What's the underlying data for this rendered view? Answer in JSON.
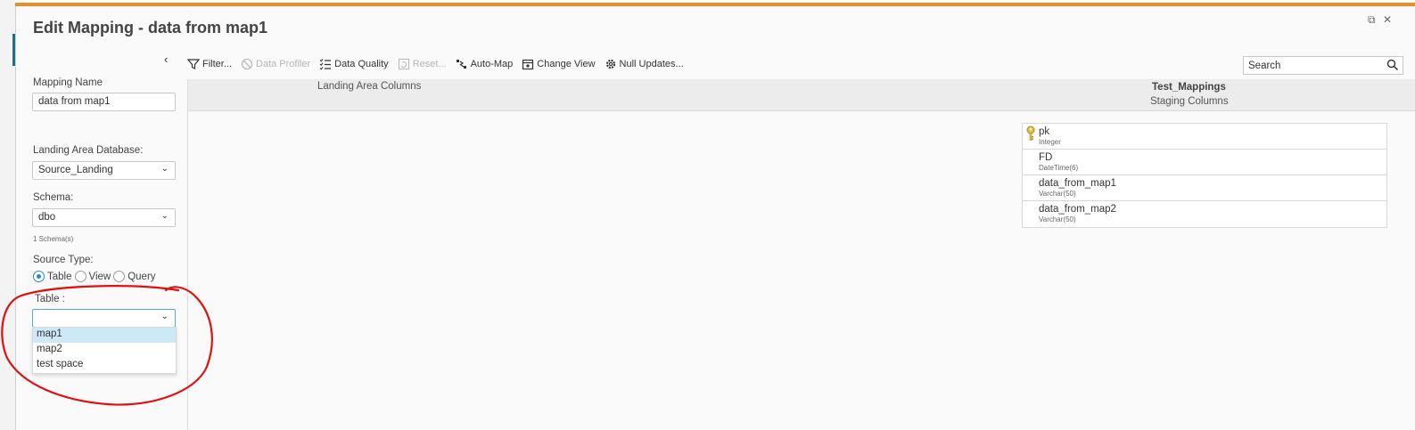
{
  "dialog": {
    "title": "Edit Mapping - data from map1"
  },
  "sidebar": {
    "mapping_name_label": "Mapping Name",
    "mapping_name_value": "data from map1",
    "landing_db_label": "Landing Area Database:",
    "landing_db_value": "Source_Landing",
    "schema_label": "Schema:",
    "schema_value": "dbo",
    "schema_count": "1 Schema(s)",
    "source_type_label": "Source Type:",
    "source_types": [
      "Table",
      "View",
      "Query"
    ],
    "source_type_selected": "Table",
    "table_label": "Table :",
    "table_value": "",
    "table_options": [
      "map1",
      "map2",
      "test space"
    ],
    "table_highlighted": "map1"
  },
  "toolbar": {
    "filter": "Filter...",
    "data_profiler": "Data Profiler",
    "data_quality": "Data Quality",
    "reset": "Reset...",
    "auto_map": "Auto-Map",
    "change_view": "Change View",
    "null_updates": "Null Updates..."
  },
  "search": {
    "placeholder": "Search"
  },
  "header": {
    "landing_columns": "Landing Area Columns",
    "staging_table": "Test_Mappings",
    "staging_columns": "Staging Columns"
  },
  "staging_columns": [
    {
      "name": "pk",
      "type": "Integer",
      "key": true
    },
    {
      "name": "FD",
      "type": "DateTime(6)",
      "key": false
    },
    {
      "name": "data_from_map1",
      "type": "Varchar(50)",
      "key": false
    },
    {
      "name": "data_from_map2",
      "type": "Varchar(50)",
      "key": false
    }
  ],
  "colors": {
    "accent_bar": "#f08a24",
    "selection": "#cde8f7",
    "radio": "#2b87c9",
    "annotation": "#e01010"
  }
}
